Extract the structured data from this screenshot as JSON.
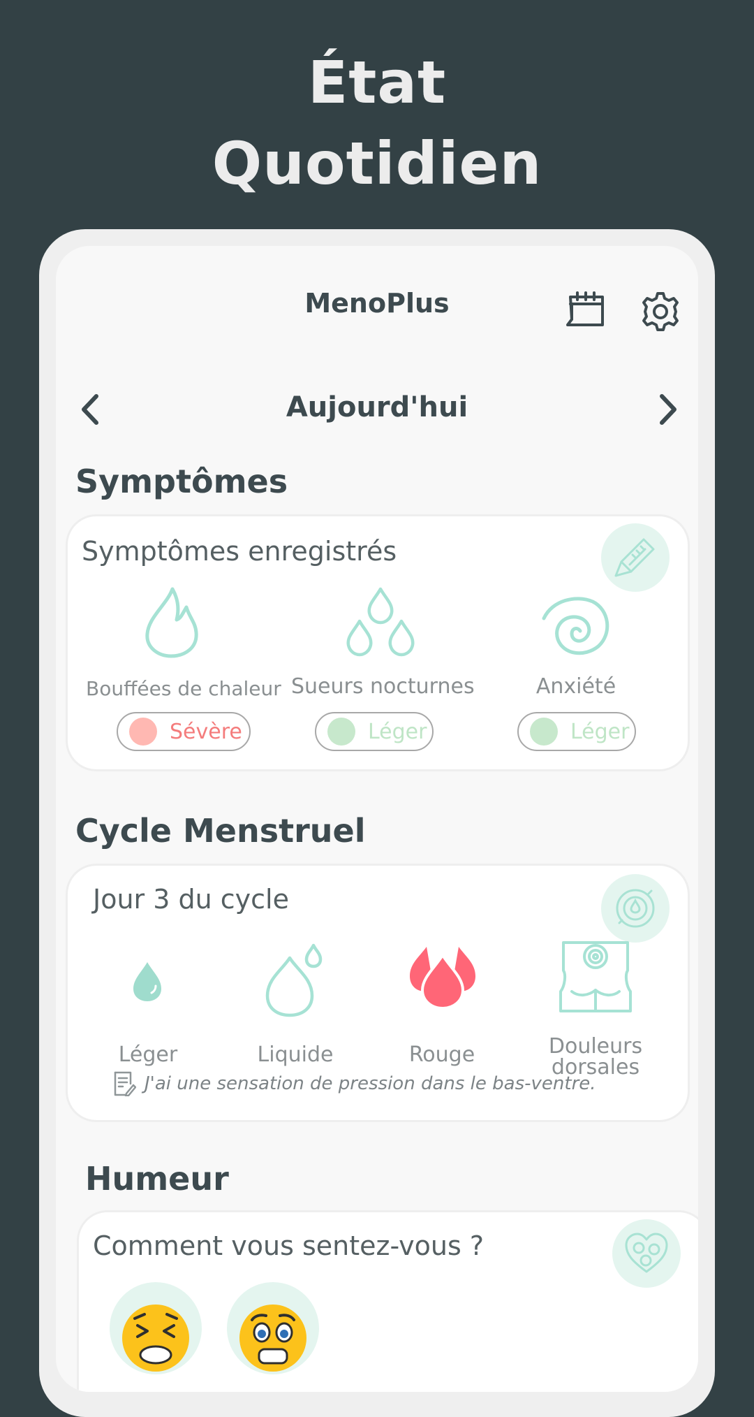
{
  "hero": {
    "line1": "État",
    "line2": "Quotidien"
  },
  "app": {
    "title": "MenoPlus"
  },
  "date_nav": {
    "title": "Aujourd'hui"
  },
  "symptoms": {
    "section_title": "Symptômes",
    "card_title": "Symptômes enregistrés",
    "items": [
      {
        "label": "Bouffées de chaleur",
        "severity": "Sévère",
        "severity_color": "#f47c7c",
        "dot_color": "#ffb8b2",
        "icon": "flame-icon"
      },
      {
        "label": "Sueurs nocturnes",
        "severity": "Léger",
        "severity_color": "#bfe5c6",
        "dot_color": "#c7e8cc",
        "icon": "droplets-icon"
      },
      {
        "label": "Anxiété",
        "severity": "Léger",
        "severity_color": "#bfe5c6",
        "dot_color": "#c7e8cc",
        "icon": "spiral-icon"
      }
    ]
  },
  "cycle": {
    "section_title": "Cycle Menstruel",
    "card_title": "Jour 3 du cycle",
    "items": [
      {
        "label": "Léger",
        "icon": "small-drop-icon"
      },
      {
        "label": "Liquide",
        "icon": "liquid-drops-icon"
      },
      {
        "label": "Rouge",
        "icon": "red-drops-icon"
      },
      {
        "label_line1": "Douleurs",
        "label_line2": "dorsales",
        "icon": "back-pain-icon"
      }
    ],
    "note": "J'ai une sensation de pression dans le bas-ventre."
  },
  "mood": {
    "section_title": "Humeur",
    "card_title": "Comment vous sentez-vous ?",
    "items": [
      {
        "icon": "tired-face-emoji-icon"
      },
      {
        "icon": "fearful-face-emoji-icon"
      }
    ]
  },
  "colors": {
    "background": "#334145",
    "accent_mint": "#9fdccd",
    "accent_red": "#ff6677",
    "text_dark": "#3d4a4f"
  }
}
